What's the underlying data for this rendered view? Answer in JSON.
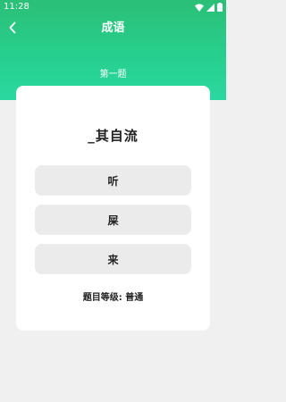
{
  "status_bar": {
    "time": "11:28",
    "icons": [
      "wifi-icon",
      "signal-icon",
      "battery-icon"
    ]
  },
  "header": {
    "title": "成语",
    "back_icon": "chevron-left-icon",
    "question_number": "第一题"
  },
  "quiz": {
    "idiom": "_其自流",
    "options": [
      "听",
      "屎",
      "来"
    ],
    "difficulty": "题目等级: 普通"
  },
  "colors": {
    "header_top": "#2bbf77",
    "header_bottom": "#2ad8a0",
    "background": "#f0f0f0",
    "card": "#ffffff",
    "option_bg": "#ebebeb",
    "text": "#222222"
  }
}
